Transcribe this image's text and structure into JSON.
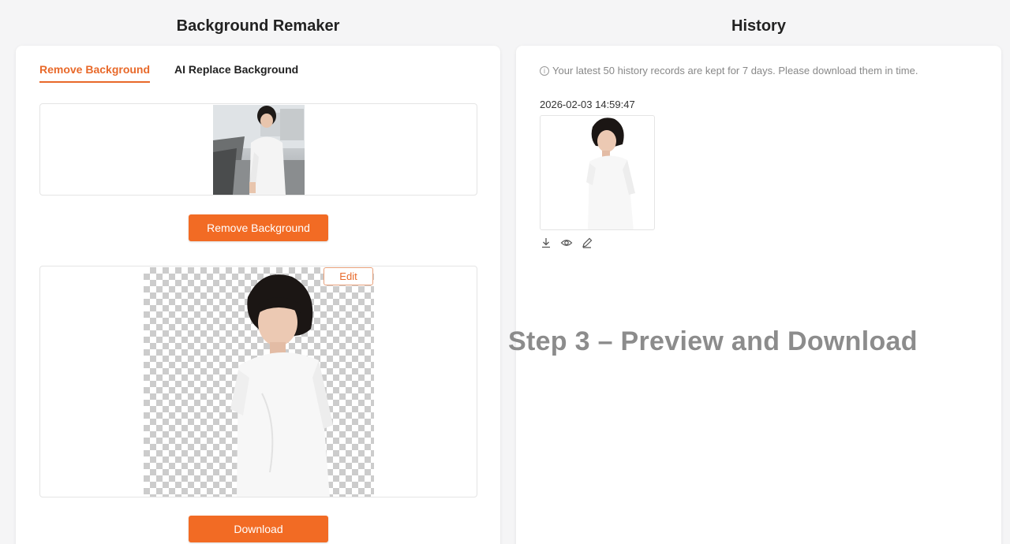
{
  "left": {
    "title": "Background Remaker",
    "tabs": [
      {
        "label": "Remove Background",
        "active": true
      },
      {
        "label": "AI Replace Background",
        "active": false
      }
    ],
    "remove_button": "Remove Background",
    "edit_button": "Edit",
    "download_button": "Download"
  },
  "right": {
    "title": "History",
    "notice": "Your latest 50 history records are kept for 7 days. Please download them in time.",
    "records": [
      {
        "timestamp": "2026-02-03 14:59:47"
      }
    ]
  },
  "overlay": {
    "caption": "Step 3 – Preview and Download"
  },
  "colors": {
    "accent": "#f26b24",
    "tab_active": "#e8692a"
  }
}
